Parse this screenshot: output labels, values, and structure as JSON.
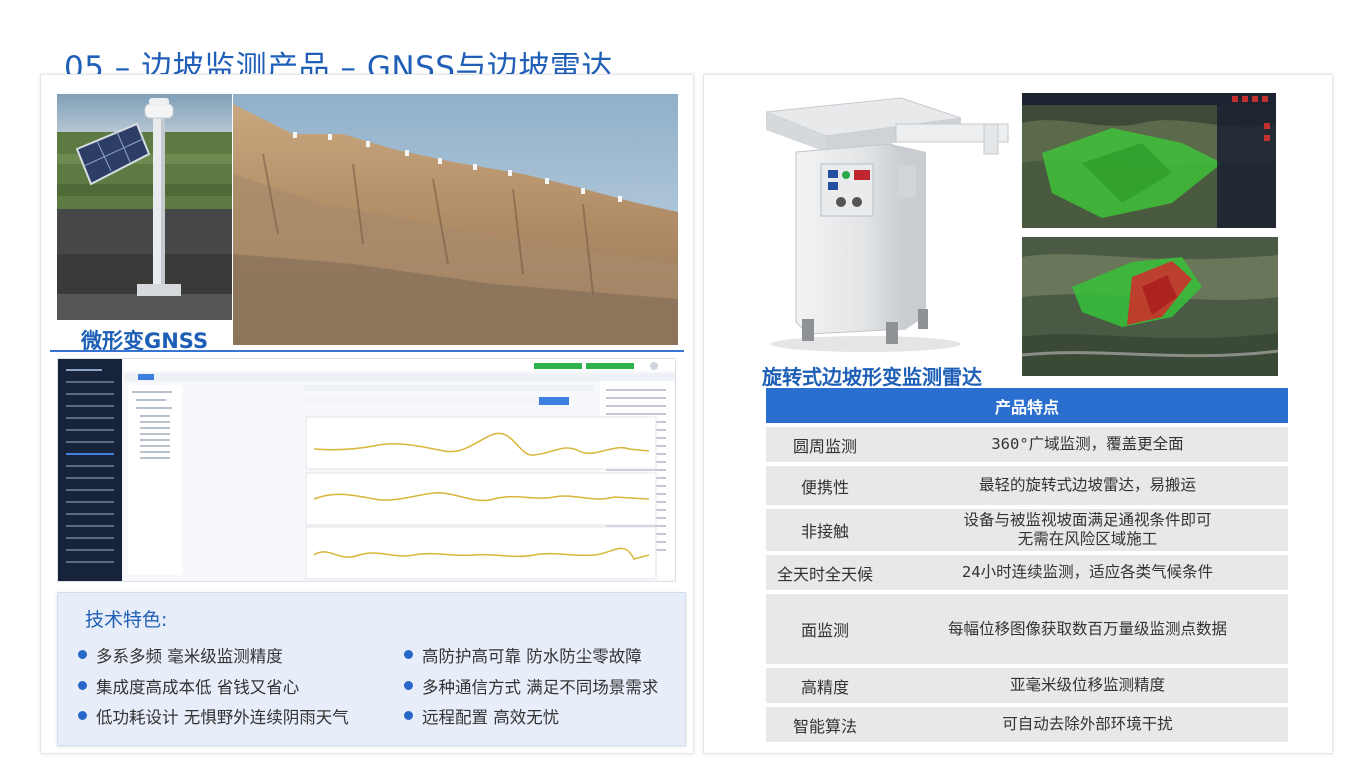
{
  "title": "05 – 边坡监测产品 – GNSS与边坡雷达",
  "gnss_label": "微形变GNSS",
  "radar_label": "旋转式边坡形变监测雷达",
  "tech": {
    "title": "技术特色:",
    "features": [
      "多系多频 毫米级监测精度",
      "高防护高可靠 防水防尘零故障",
      "集成度高成本低 省钱又省心",
      "多种通信方式 满足不同场景需求",
      "低功耗设计 无惧野外连续阴雨天气",
      "远程配置 高效无忧"
    ]
  },
  "table": {
    "header": "产品特点",
    "rows": [
      {
        "name": "圆周监测",
        "desc": "360°广域监测，覆盖更全面"
      },
      {
        "name": "便携性",
        "desc": "最轻的旋转式边坡雷达，易搬运"
      },
      {
        "name": "非接触",
        "desc": "设备与被监视坡面满足通视条件即可\n无需在风险区域施工"
      },
      {
        "name": "全天时全天候",
        "desc": "24小时连续监测，适应各类气候条件"
      },
      {
        "name": "面监测",
        "desc": "每幅位移图像获取数百万量级监测点数据"
      },
      {
        "name": "高精度",
        "desc": "亚毫米级位移监测精度"
      },
      {
        "name": "智能算法",
        "desc": "可自动去除外部环境干扰"
      }
    ]
  },
  "colors": {
    "brand_blue": "#1f5fb8",
    "table_header": "#2a6fcf",
    "tech_bg": "#e7eef9"
  }
}
